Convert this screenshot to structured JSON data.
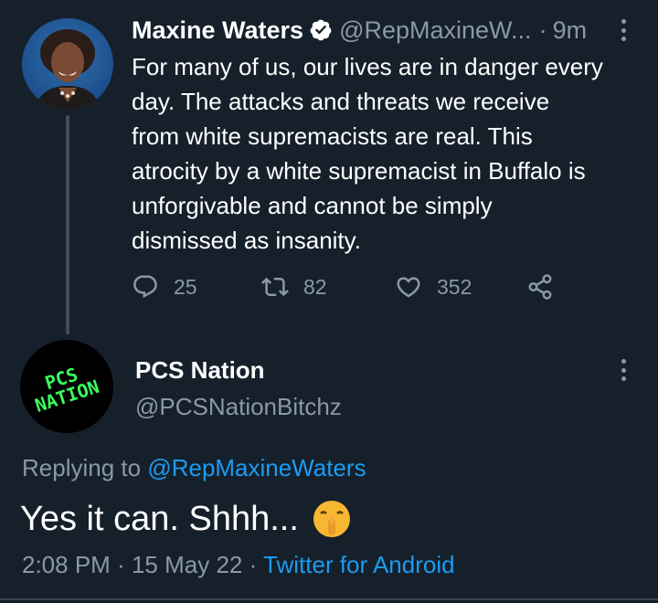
{
  "tweet": {
    "author_name": "Maxine Waters",
    "author_handle": "@RepMaxineW...",
    "separator": "·",
    "time_ago": "9m",
    "text": "For many of us, our lives are in danger every\nday. The attacks and threats we receive\nfrom white supremacists are real. This\natrocity by a white supremacist in Buffalo is\nunforgivable and cannot be simply\ndismissed as insanity.",
    "actions": {
      "reply_count": "25",
      "retweet_count": "82",
      "like_count": "352"
    },
    "icons": [
      "verified-badge-icon",
      "more-vertical-icon",
      "reply-icon",
      "retweet-icon",
      "like-icon",
      "share-icon"
    ]
  },
  "reply": {
    "author_name": "PCS Nation",
    "author_handle": "@PCSNationBitchz",
    "avatar_text_line1": "PCS",
    "avatar_text_line2": "NATION",
    "replying_prefix": "Replying to",
    "replying_mention": "@RepMaxineWaters",
    "text": "Yes it can. Shhh...",
    "emoji": "shushing-face-icon",
    "time": "2:08 PM",
    "sep1": "·",
    "date": "15 May 22",
    "sep2": "·",
    "source": "Twitter for Android"
  },
  "colors": {
    "background": "#15202b",
    "text": "#ffffff",
    "secondary": "#8b98a5",
    "link": "#1d9bf0",
    "avatar_text": "#39ff5a"
  }
}
